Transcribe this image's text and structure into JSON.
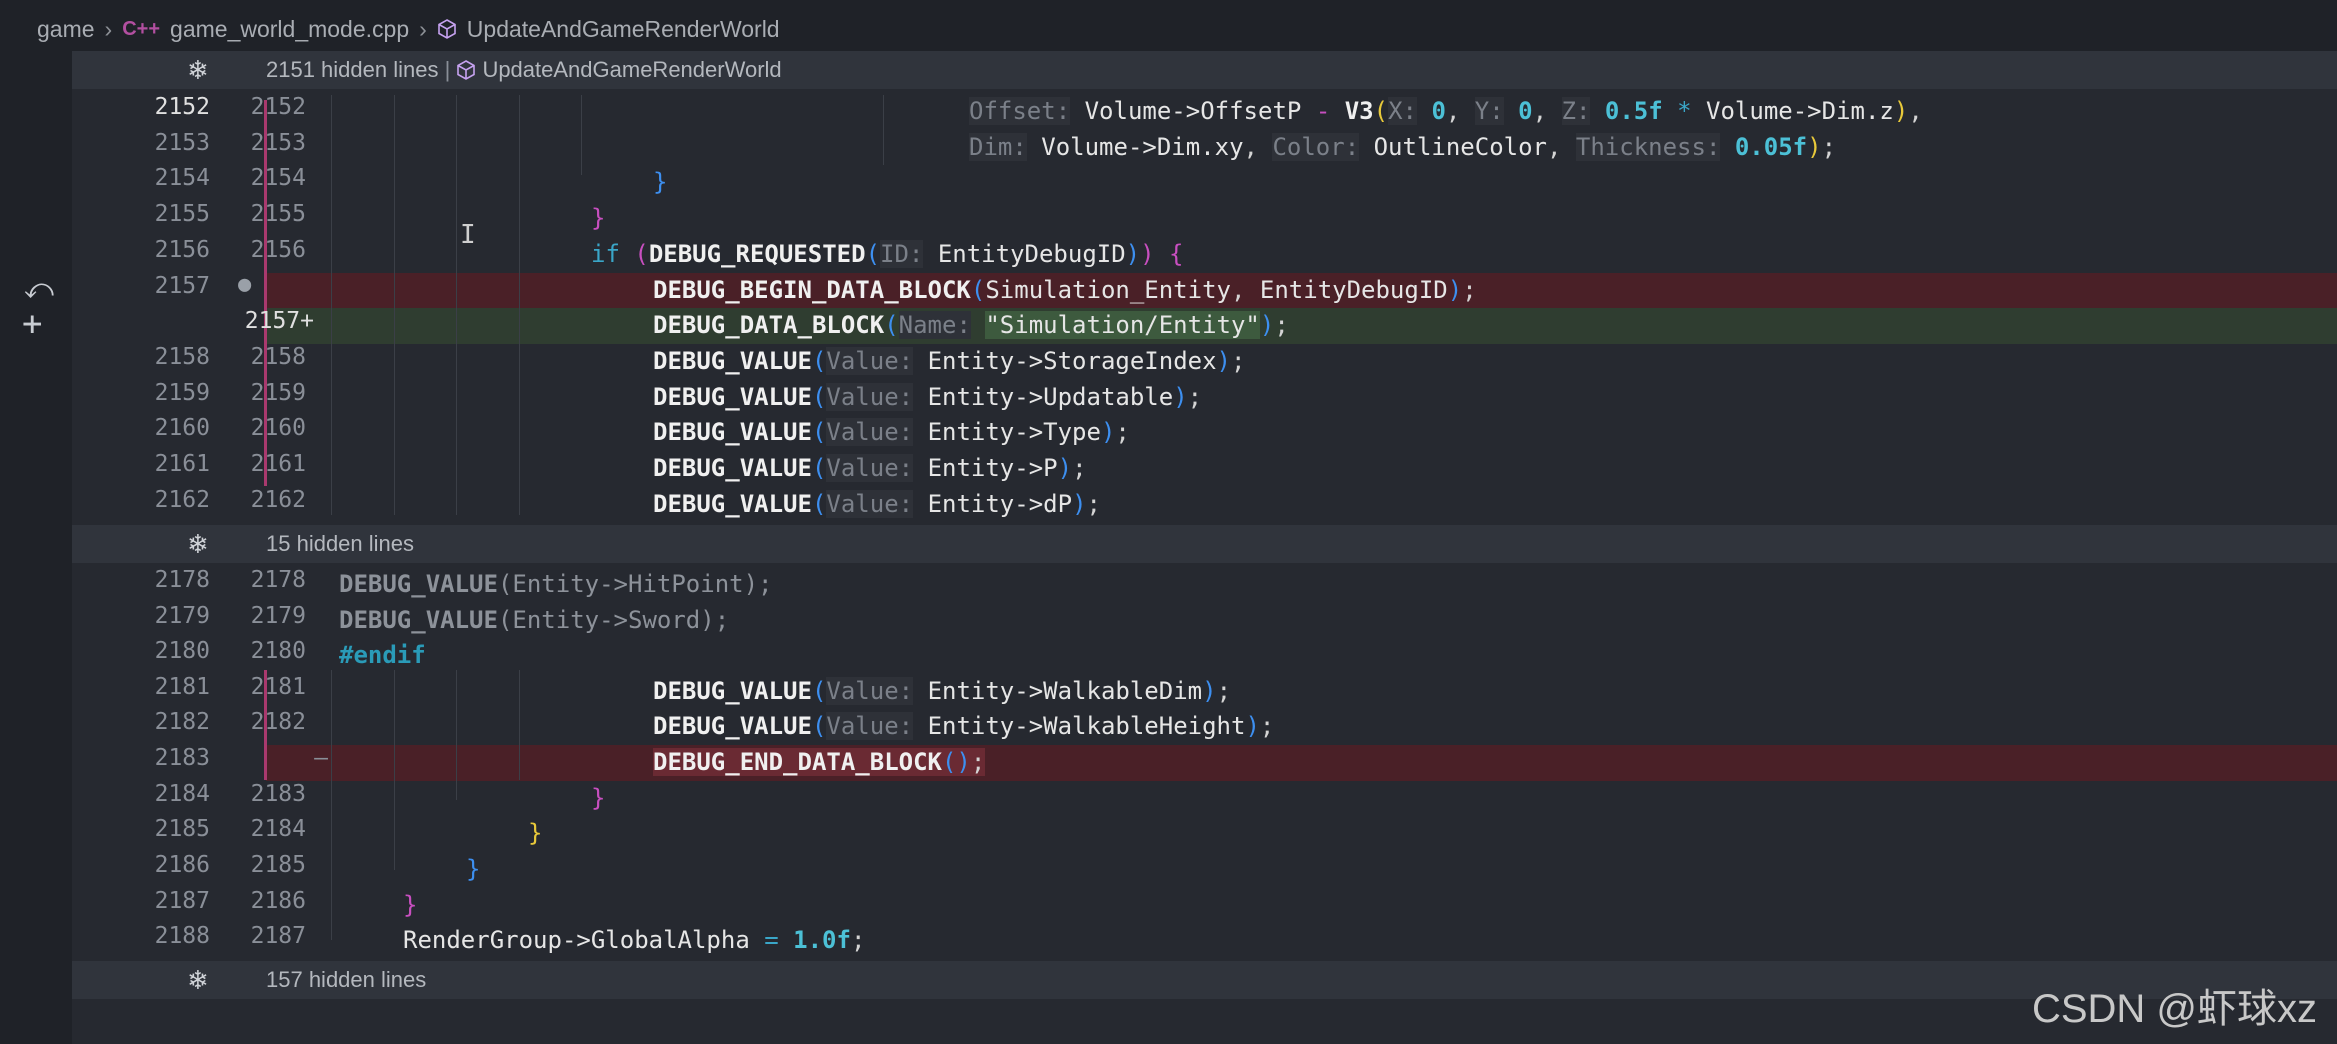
{
  "breadcrumb": {
    "root": "game",
    "file_icon": "C++",
    "file": "game_world_mode.cpp",
    "symbol": "UpdateAndGameRenderWorld"
  },
  "hidden_regions": [
    {
      "label": "2151 hidden lines",
      "symbol": "UpdateAndGameRenderWorld"
    },
    {
      "label": "15 hidden lines",
      "symbol": ""
    },
    {
      "label": "157 hidden lines",
      "symbol": ""
    }
  ],
  "gutter": {
    "revert_icon": "revert-icon",
    "add_icon": "plus-icon"
  },
  "watermark": "CSDN @虾球xz",
  "lines": [
    {
      "a": "2152",
      "b": "2152"
    },
    {
      "a": "2153",
      "b": "2153"
    },
    {
      "a": "2154",
      "b": "2154"
    },
    {
      "a": "2155",
      "b": "2155"
    },
    {
      "a": "2156",
      "b": "2156"
    },
    {
      "a": "2157",
      "b": ""
    },
    {
      "a": "",
      "b": "2157+"
    },
    {
      "a": "2158",
      "b": "2158"
    },
    {
      "a": "2159",
      "b": "2159"
    },
    {
      "a": "2160",
      "b": "2160"
    },
    {
      "a": "2161",
      "b": "2161"
    },
    {
      "a": "2162",
      "b": "2162"
    },
    {
      "a": "2178",
      "b": "2178"
    },
    {
      "a": "2179",
      "b": "2179"
    },
    {
      "a": "2180",
      "b": "2180"
    },
    {
      "a": "2181",
      "b": "2181"
    },
    {
      "a": "2182",
      "b": "2182"
    },
    {
      "a": "2183",
      "b": "—"
    },
    {
      "a": "2184",
      "b": "2183"
    },
    {
      "a": "2185",
      "b": "2184"
    },
    {
      "a": "2186",
      "b": "2185"
    },
    {
      "a": "2187",
      "b": "2186"
    },
    {
      "a": "2188",
      "b": "2187"
    }
  ]
}
